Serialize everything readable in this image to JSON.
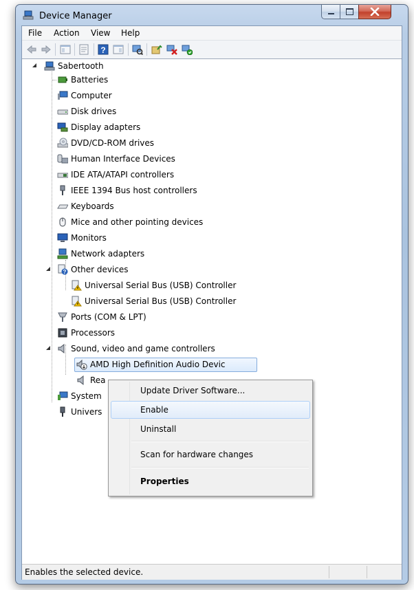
{
  "window": {
    "title": "Device Manager"
  },
  "menu": [
    "File",
    "Action",
    "View",
    "Help"
  ],
  "toolbar": {
    "buttons": [
      "back-icon",
      "forward-icon",
      "show-hide-console-tree-icon",
      "properties-icon",
      "help-icon",
      "show-action-pane-icon",
      "scan-hardware-icon",
      "update-driver-icon",
      "uninstall-icon",
      "enable-icon"
    ]
  },
  "tree": {
    "root": "Sabertooth",
    "categories": [
      {
        "label": "Batteries",
        "expanded": false
      },
      {
        "label": "Computer",
        "expanded": false
      },
      {
        "label": "Disk drives",
        "expanded": false
      },
      {
        "label": "Display adapters",
        "expanded": false
      },
      {
        "label": "DVD/CD-ROM drives",
        "expanded": false
      },
      {
        "label": "Human Interface Devices",
        "expanded": false
      },
      {
        "label": "IDE ATA/ATAPI controllers",
        "expanded": false
      },
      {
        "label": "IEEE 1394 Bus host controllers",
        "expanded": false
      },
      {
        "label": "Keyboards",
        "expanded": false
      },
      {
        "label": "Mice and other pointing devices",
        "expanded": false
      },
      {
        "label": "Monitors",
        "expanded": false
      },
      {
        "label": "Network adapters",
        "expanded": false
      },
      {
        "label": "Other devices",
        "expanded": true
      },
      {
        "label": "Universal Serial Bus (USB) Controller",
        "child": true
      },
      {
        "label": "Universal Serial Bus (USB) Controller",
        "child": true
      },
      {
        "label": "Ports (COM & LPT)",
        "expanded": false
      },
      {
        "label": "Processors",
        "expanded": false
      },
      {
        "label": "Sound, video and game controllers",
        "expanded": true
      },
      {
        "label": "AMD High Definition Audio Device",
        "child": true,
        "selected": true
      },
      {
        "label": "Realtek High Definition Audio",
        "child": true
      },
      {
        "label": "System devices",
        "expanded": false
      },
      {
        "label": "Universal Serial Bus controllers",
        "expanded": false
      }
    ]
  },
  "visible_labels": {
    "amd_device": "AMD High Definition Audio Devic",
    "realtek": "Rea",
    "system": "System",
    "univers": "Univers"
  },
  "context_menu": {
    "items": [
      "Update Driver Software...",
      "Enable",
      "Uninstall",
      "Scan for hardware changes",
      "Properties"
    ],
    "highlighted": "Enable"
  },
  "status": {
    "text": "Enables the selected device."
  },
  "colors": {
    "selection": "#dbeafc",
    "selection_border": "#84acdd",
    "warning": "#f5c400"
  }
}
